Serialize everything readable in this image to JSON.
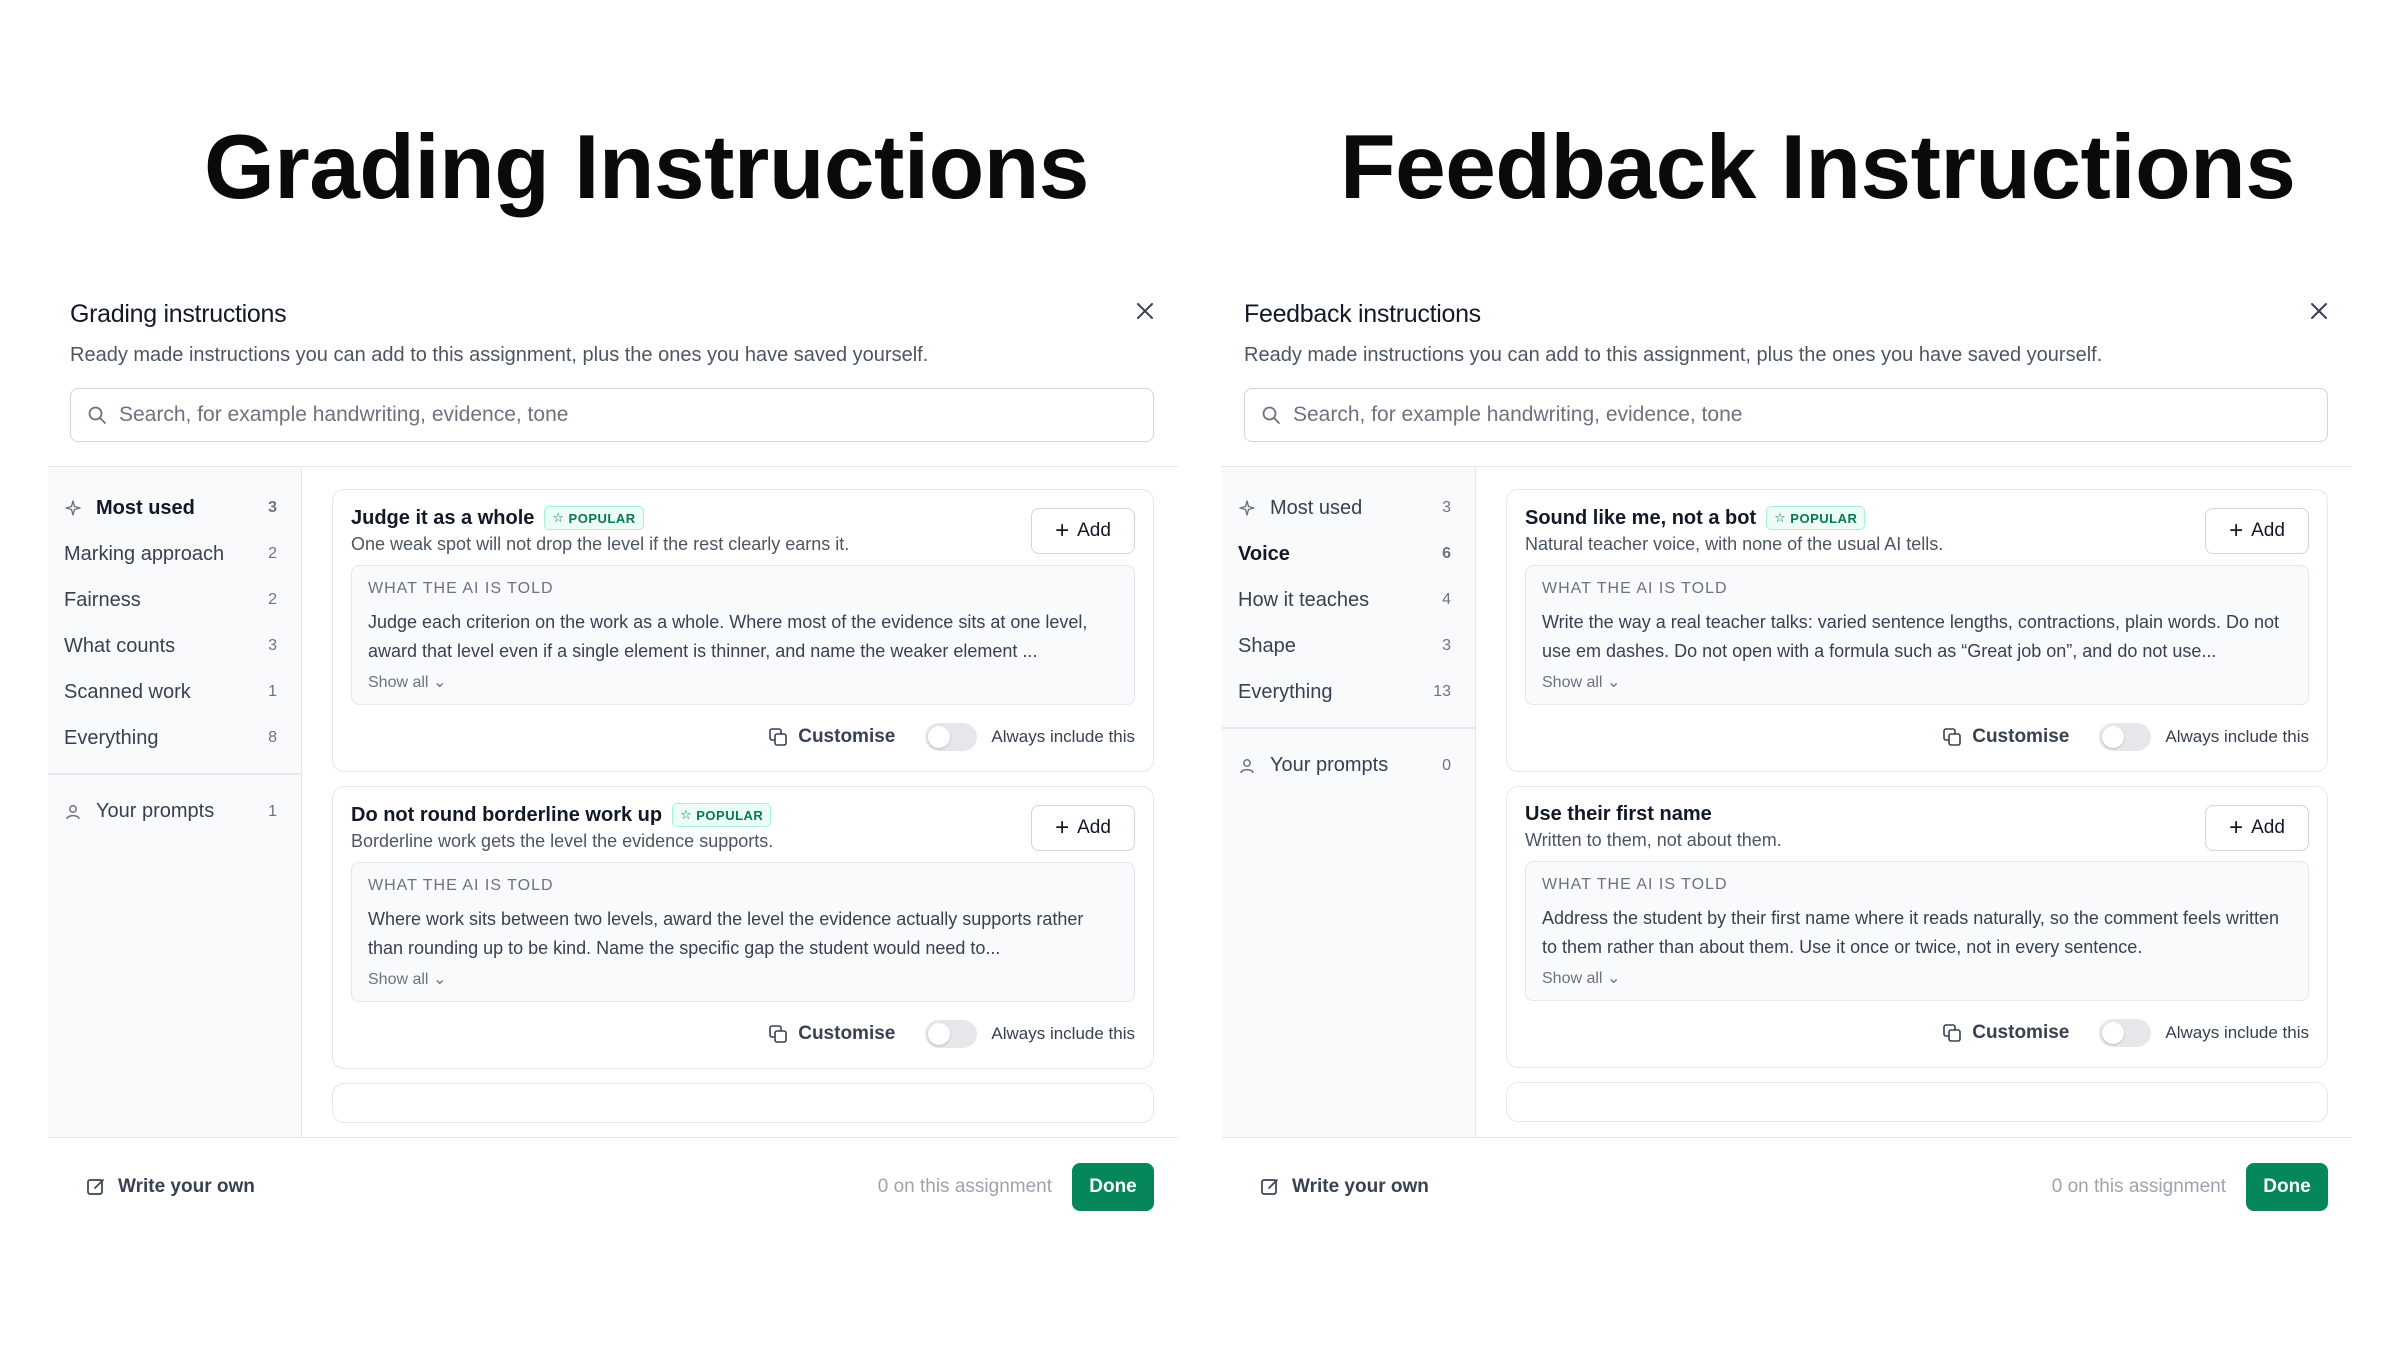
{
  "headings": {
    "left": "Grading Instructions",
    "right": "Feedback Instructions"
  },
  "panels": [
    {
      "title": "Grading instructions",
      "subtitle": "Ready made instructions you can add to this assignment, plus the ones you have saved yourself.",
      "search_placeholder": "Search, for example handwriting, evidence, tone",
      "sidebar": [
        {
          "label": "Most used",
          "count": "3",
          "icon": "sparkle-icon"
        },
        {
          "label": "Marking approach",
          "count": "2"
        },
        {
          "label": "Fairness",
          "count": "2"
        },
        {
          "label": "What counts",
          "count": "3"
        },
        {
          "label": "Scanned work",
          "count": "1"
        },
        {
          "label": "Everything",
          "count": "8"
        }
      ],
      "your_prompts": {
        "label": "Your prompts",
        "count": "1",
        "icon": "person-icon"
      },
      "active_item": "Most used",
      "cards": [
        {
          "title": "Judge it as a whole",
          "badge": "POPULAR",
          "description": "One weak spot will not drop the level if the rest clearly earns it.",
          "told_label": "WHAT THE AI IS TOLD",
          "told_text": "Judge each criterion on the work as a whole. Where most of the evidence sits at one level, award that level even if a single element is thinner, and name the weaker element ...",
          "show_all": "Show all"
        },
        {
          "title": "Do not round borderline work up",
          "badge": "POPULAR",
          "description": "Borderline work gets the level the evidence supports.",
          "told_label": "WHAT THE AI IS TOLD",
          "told_text": "Where work sits between two levels, award the level the evidence actually supports rather than rounding up to be kind. Name the specific gap the student would need to...",
          "show_all": "Show all"
        }
      ],
      "add_label": "Add",
      "customise_label": "Customise",
      "always_label": "Always include this",
      "write_own": "Write your own",
      "assignment_count": "0 on this assignment",
      "done": "Done"
    },
    {
      "title": "Feedback instructions",
      "subtitle": "Ready made instructions you can add to this assignment, plus the ones you have saved yourself.",
      "search_placeholder": "Search, for example handwriting, evidence, tone",
      "sidebar": [
        {
          "label": "Most used",
          "count": "3",
          "icon": "sparkle-icon"
        },
        {
          "label": "Voice",
          "count": "6"
        },
        {
          "label": "How it teaches",
          "count": "4"
        },
        {
          "label": "Shape",
          "count": "3"
        },
        {
          "label": "Everything",
          "count": "13"
        }
      ],
      "your_prompts": {
        "label": "Your prompts",
        "count": "0",
        "icon": "person-icon"
      },
      "active_item": "Voice",
      "cards": [
        {
          "title": "Sound like me, not a bot",
          "badge": "POPULAR",
          "description": "Natural teacher voice, with none of the usual AI tells.",
          "told_label": "WHAT THE AI IS TOLD",
          "told_text": "Write the way a real teacher talks: varied sentence lengths, contractions, plain words. Do not use em dashes. Do not open with a formula such as “Great job on”, and do not use...",
          "show_all": "Show all"
        },
        {
          "title": "Use their first name",
          "badge": "",
          "description": "Written to them, not about them.",
          "told_label": "WHAT THE AI IS TOLD",
          "told_text": "Address the student by their first name where it reads naturally, so the comment feels written to them rather than about them. Use it once or twice, not in every sentence.",
          "show_all": "Show all"
        }
      ],
      "add_label": "Add",
      "customise_label": "Customise",
      "always_label": "Always include this",
      "write_own": "Write your own",
      "assignment_count": "0 on this assignment",
      "done": "Done"
    }
  ]
}
